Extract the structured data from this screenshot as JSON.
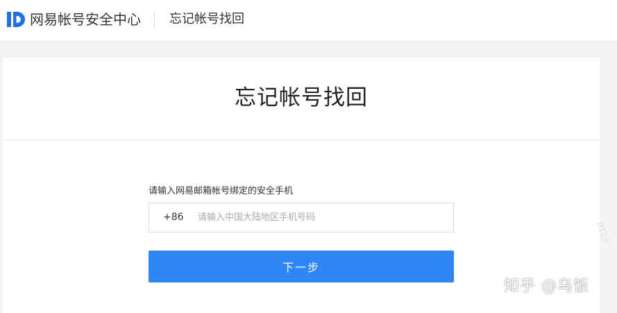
{
  "header": {
    "brand": "网易帐号安全中心",
    "subtitle": "忘记帐号找回"
  },
  "main": {
    "title": "忘记帐号找回",
    "phone_label": "请输入网易邮箱帐号绑定的安全手机",
    "country_code": "+86",
    "phone_placeholder": "请输入中国大陆地区手机号码",
    "phone_value": "",
    "next_label": "下一步"
  },
  "watermark": {
    "text": "知乎 @乌饭",
    "edge_text": "0113"
  },
  "colors": {
    "brand_blue": "#1f6fe5",
    "button_blue": "#2f86f6",
    "background": "#f3f3f3"
  },
  "icons": {
    "logo": "netease-id-logo"
  }
}
